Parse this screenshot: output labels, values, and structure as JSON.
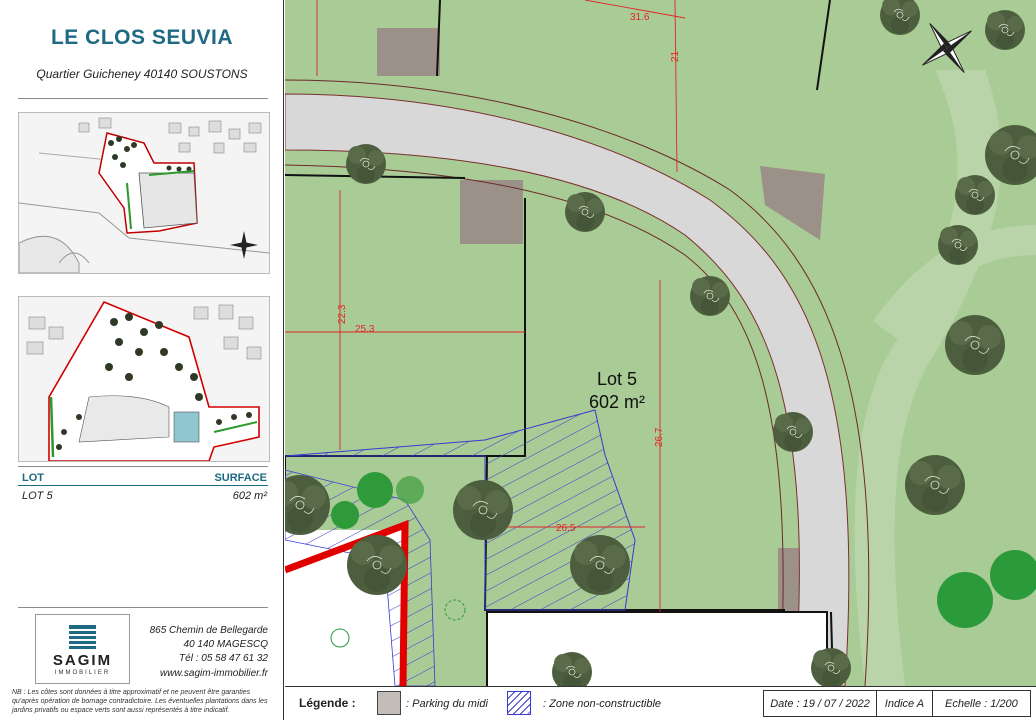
{
  "sidebar": {
    "title": "LE CLOS SEUVIA",
    "address": "Quartier Guicheney 40140 SOUSTONS",
    "table": {
      "col_lot": "LOT",
      "col_surface": "SURFACE",
      "lot": "LOT 5",
      "surface": "602 m²"
    },
    "company": {
      "logo_name": "SAGIM",
      "logo_sub": "IMMOBILIER",
      "street": "865 Chemin de Bellegarde",
      "city": "40 140 MAGESCQ",
      "phone": "Tél : 05 58 47 61 32",
      "website": "www.sagim-immobilier.fr"
    },
    "note": "NB : Les côtes sont données à titre approximatif et ne peuvent être garanties qu'après opération de bornage contradictoire. Les éventuelles plantations dans les jardins privatifs ou espace verts sont aussi représentés à titre indicatif."
  },
  "map": {
    "lot_label": "Lot 5",
    "lot_area": "602 m²",
    "dimensions": [
      "31.6",
      "21",
      "22.3",
      "25.3",
      "26.7",
      "26.5"
    ],
    "colors": {
      "grass": "#a9cb95",
      "road": "#d8d8d8",
      "parking": "#9c9189",
      "tree": "#4d5e3f",
      "dimension_line": "#e0262a",
      "hatch": "#3a3ad0",
      "boundary": "#e00000"
    }
  },
  "legend": {
    "title": "Légende :",
    "parking": ": Parking du midi",
    "zone": ": Zone non-constructible",
    "date": "Date : 19 / 07 / 2022",
    "index": "Indice A",
    "scale": "Echelle : 1/200"
  }
}
